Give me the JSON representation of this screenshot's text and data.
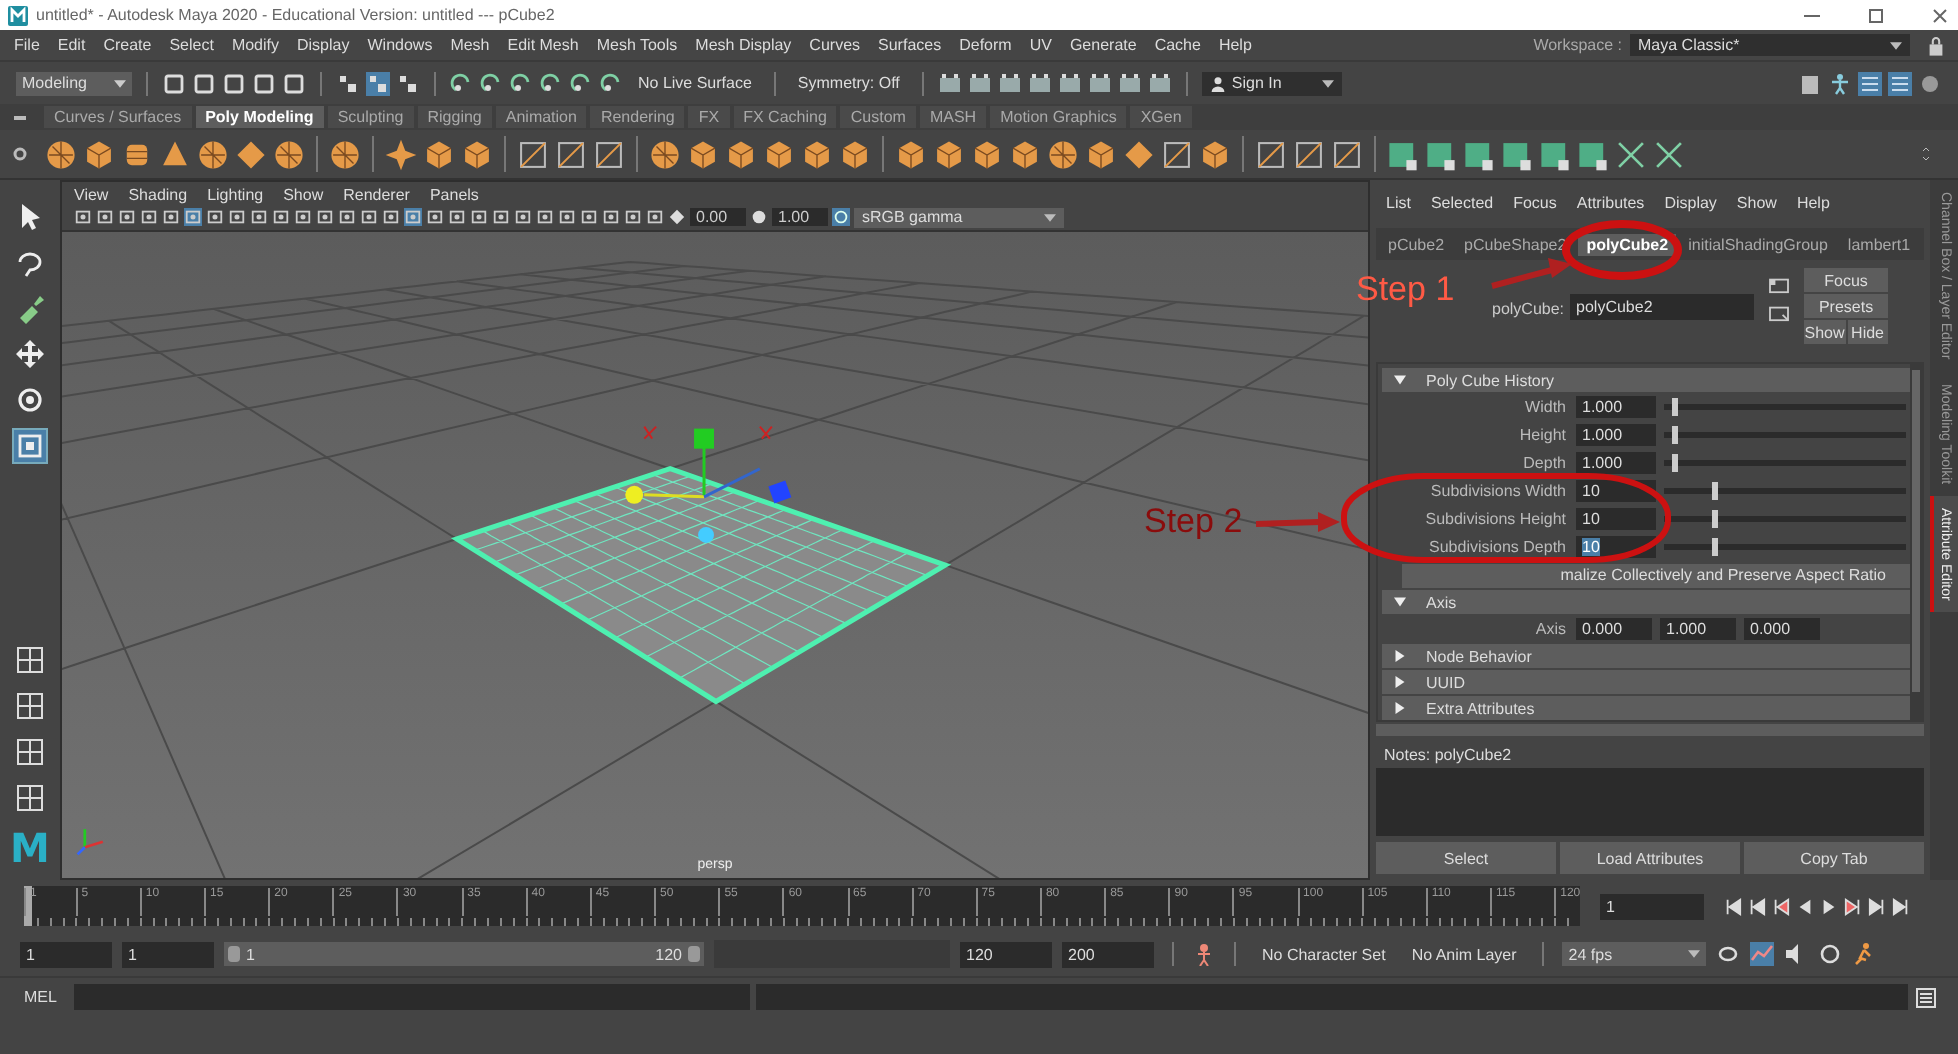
{
  "window": {
    "title": "untitled* - Autodesk Maya 2020 - Educational Version: untitled  ---  pCube2"
  },
  "menu_bar": {
    "items": [
      "File",
      "Edit",
      "Create",
      "Select",
      "Modify",
      "Display",
      "Windows",
      "Mesh",
      "Edit Mesh",
      "Mesh Tools",
      "Mesh Display",
      "Curves",
      "Surfaces",
      "Deform",
      "UV",
      "Generate",
      "Cache",
      "Help"
    ],
    "workspace_label": "Workspace :",
    "workspace": "Maya Classic*"
  },
  "status_line": {
    "mode": "Modeling",
    "live_surface": "No Live Surface",
    "symmetry": "Symmetry: Off",
    "sign_in": "Sign In"
  },
  "shelf": {
    "tabs": [
      {
        "label": "Curves / Surfaces",
        "selected": false
      },
      {
        "label": "Poly Modeling",
        "selected": true
      },
      {
        "label": "Sculpting",
        "selected": false
      },
      {
        "label": "Rigging",
        "selected": false
      },
      {
        "label": "Animation",
        "selected": false
      },
      {
        "label": "Rendering",
        "selected": false
      },
      {
        "label": "FX",
        "selected": false
      },
      {
        "label": "FX Caching",
        "selected": false
      },
      {
        "label": "Custom",
        "selected": false
      },
      {
        "label": "MASH",
        "selected": false
      },
      {
        "label": "Motion Graphics",
        "selected": false
      },
      {
        "label": "XGen",
        "selected": false
      }
    ]
  },
  "logo": "M",
  "viewport": {
    "menus": [
      "View",
      "Shading",
      "Lighting",
      "Show",
      "Renderer",
      "Panels"
    ],
    "exposure": "0.00",
    "gamma": "1.00",
    "color_space": "sRGB gamma",
    "camera": "persp"
  },
  "attribute_editor": {
    "menus": [
      "List",
      "Selected",
      "Focus",
      "Attributes",
      "Display",
      "Show",
      "Help"
    ],
    "tabs": [
      {
        "label": "pCube2",
        "selected": false
      },
      {
        "label": "pCubeShape2",
        "selected": false
      },
      {
        "label": "polyCube2",
        "selected": true
      },
      {
        "label": "initialShadingGroup",
        "selected": false
      },
      {
        "label": "lambert1",
        "selected": false
      }
    ],
    "node_label": "polyCube:",
    "node_name": "polyCube2",
    "focus": "Focus",
    "presets": "Presets",
    "show": "Show",
    "hide": "Hide",
    "sections": [
      {
        "title": "Poly Cube History",
        "expanded": true,
        "rows": [
          {
            "kind": "slider",
            "label": "Width",
            "value": "1.000",
            "level": 0.03,
            "selected": false
          },
          {
            "kind": "slider",
            "label": "Height",
            "value": "1.000",
            "level": 0.03,
            "selected": false
          },
          {
            "kind": "slider",
            "label": "Depth",
            "value": "1.000",
            "level": 0.03,
            "selected": false
          },
          {
            "kind": "slider",
            "label": "Subdivisions Width",
            "value": "10",
            "level": 0.2,
            "selected": false
          },
          {
            "kind": "slider",
            "label": "Subdivisions Height",
            "value": "10",
            "level": 0.2,
            "selected": false
          },
          {
            "kind": "slider",
            "label": "Subdivisions Depth",
            "value": "10",
            "level": 0.2,
            "selected": true
          },
          {
            "kind": "button",
            "label": "malize Collectively and Preserve Aspect Ratio"
          }
        ]
      },
      {
        "title": "Axis",
        "expanded": true,
        "rows": [
          {
            "kind": "vector",
            "label": "Axis",
            "values": [
              "0.000",
              "1.000",
              "0.000"
            ]
          }
        ]
      },
      {
        "title": "Node Behavior",
        "expanded": false
      },
      {
        "title": "UUID",
        "expanded": false
      },
      {
        "title": "Extra Attributes",
        "expanded": false
      }
    ],
    "notes_label": "Notes:  polyCube2",
    "bottom_buttons": [
      "Select",
      "Load Attributes",
      "Copy Tab"
    ]
  },
  "side_tabs": [
    {
      "label": "Channel Box / Layer Editor",
      "selected": false
    },
    {
      "label": "Modeling Toolkit",
      "selected": false
    },
    {
      "label": "Attribute Editor",
      "selected": true
    }
  ],
  "time_slider": {
    "ticks": [
      "1",
      "5",
      "10",
      "15",
      "20",
      "25",
      "30",
      "35",
      "40",
      "45",
      "50",
      "55",
      "60",
      "65",
      "70",
      "75",
      "80",
      "85",
      "90",
      "95",
      "100",
      "105",
      "110",
      "115",
      "120"
    ],
    "current_frame": "1"
  },
  "range_slider": {
    "start": "1",
    "playback_start": "1",
    "range_start": "1",
    "range_end": "120",
    "level": 1,
    "playback_end": "120",
    "end": "200",
    "character_set": "No Character Set",
    "anim_layer": "No Anim Layer",
    "fps": "24 fps"
  },
  "command_line": {
    "language": "MEL"
  },
  "annotations": [
    {
      "label": "Step 1"
    },
    {
      "label": "Step 2"
    }
  ]
}
